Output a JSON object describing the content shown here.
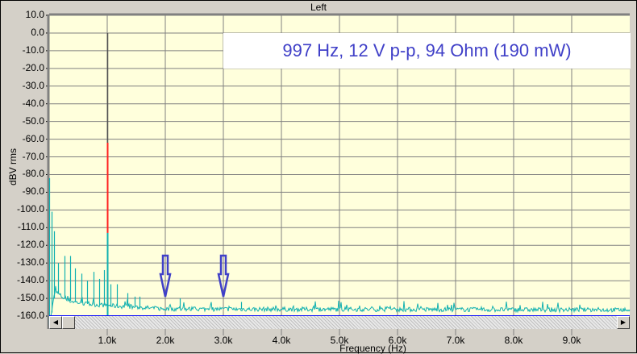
{
  "window": {
    "title": "Left"
  },
  "annotation": "997 Hz, 12 V p-p,  94 Ohm  (190 mW)",
  "colors": {
    "plot_bg": "#ffffdc",
    "grid": "#808080",
    "trace": "#10b0b0",
    "fundamental_mid": "#ff2020",
    "fundamental_top": "#505050",
    "annotation_text": "#4040c8",
    "axis_line": "#0000ff"
  },
  "scrollbar": {
    "left_arrow": "◀",
    "right_arrow": "▶"
  },
  "chart_data": {
    "type": "line",
    "title": "Left",
    "xlabel": "Frequency (Hz)",
    "ylabel": "dBV rms",
    "xlim": [
      0,
      10000
    ],
    "ylim": [
      -160,
      10
    ],
    "grid": true,
    "yticks": [
      "10.0",
      "0.0",
      "-10.0",
      "-20.0",
      "-30.0",
      "-40.0",
      "-50.0",
      "-60.0",
      "-70.0",
      "-80.0",
      "-90.0",
      "-100.0",
      "-110.0",
      "-120.0",
      "-130.0",
      "-140.0",
      "-150.0",
      "-160.0"
    ],
    "xticks": [
      "1.0k",
      "2.0k",
      "3.0k",
      "4.0k",
      "5.0k",
      "6.0k",
      "7.0k",
      "8.0k",
      "9.0k"
    ],
    "fundamental": {
      "freq": 997,
      "db": 0.0
    },
    "peaks": [
      [
        5,
        -82
      ],
      [
        40,
        -101
      ],
      [
        80,
        -112
      ],
      [
        149,
        -130
      ],
      [
        264,
        -126
      ],
      [
        357,
        -126
      ],
      [
        449,
        -133
      ],
      [
        551,
        -136
      ],
      [
        657,
        -140
      ],
      [
        764,
        -135
      ],
      [
        865,
        -139
      ],
      [
        949,
        -134
      ],
      [
        1056,
        -142
      ],
      [
        1167,
        -142
      ],
      [
        1347,
        -147
      ],
      [
        1468,
        -149
      ],
      [
        1560,
        -149
      ],
      [
        2250,
        -150
      ],
      [
        3300,
        -152
      ]
    ],
    "noise_floor": [
      [
        100,
        -146
      ],
      [
        300,
        -151
      ],
      [
        600,
        -153
      ],
      [
        1000,
        -154
      ],
      [
        2000,
        -156
      ],
      [
        10000,
        -156.5
      ]
    ],
    "markers": [
      {
        "type": "down-arrow",
        "freq": 2000
      },
      {
        "type": "down-arrow",
        "freq": 3000
      }
    ]
  }
}
